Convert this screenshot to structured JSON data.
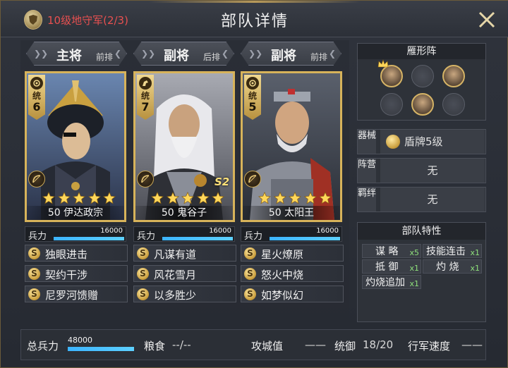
{
  "header": {
    "level_title": "10级地守军(2/3)",
    "page_title": "部队详情"
  },
  "generals": [
    {
      "role": "主将",
      "position": "前排",
      "cost_label": "统",
      "cost": "6",
      "level": "50",
      "name": "伊达政宗",
      "stars": 5,
      "troop_label": "兵力",
      "troops": "16000",
      "troop_fill": 1.0,
      "skills": [
        "独眼进击",
        "契约干涉",
        "尼罗河馈赠"
      ],
      "art_palette": {
        "bg": "#3a4a66",
        "armor": "#2a2e3a",
        "face": "#d8b890"
      }
    },
    {
      "role": "副将",
      "position": "后排",
      "cost_label": "统",
      "cost": "7",
      "level": "50",
      "name": "鬼谷子",
      "stars": 5,
      "badge": "S2",
      "troop_label": "兵力",
      "troops": "16000",
      "troop_fill": 1.0,
      "skills": [
        "凡谋有道",
        "风花雪月",
        "以多胜少"
      ],
      "art_palette": {
        "bg": "#6a6e78",
        "armor": "#3c3e44",
        "face": "#c9a27e"
      }
    },
    {
      "role": "副将",
      "position": "前排",
      "cost_label": "统",
      "cost": "5",
      "level": "50",
      "name": "太阳王",
      "stars": 5,
      "troop_label": "兵力",
      "troops": "16000",
      "troop_fill": 1.0,
      "skills": [
        "星火燎原",
        "怒火中烧",
        "如梦似幻"
      ],
      "art_palette": {
        "bg": "#3e4450",
        "armor": "#7a7e86",
        "face": "#d0a580"
      }
    }
  ],
  "formation": {
    "title": "雁形阵",
    "slots": [
      {
        "state": "filled",
        "crown": true
      },
      {
        "state": "empty"
      },
      {
        "state": "filled"
      },
      {
        "state": "empty"
      },
      {
        "state": "filled"
      },
      {
        "state": "empty"
      }
    ]
  },
  "info": [
    {
      "key": "器械",
      "value": "盾牌5级",
      "icon": "shield-icon"
    },
    {
      "key": "阵营",
      "value": "无"
    },
    {
      "key": "羁绊",
      "value": "无"
    }
  ],
  "traits": {
    "title": "部队特性",
    "items": [
      {
        "name": "谋 略",
        "count": "x5"
      },
      {
        "name": "技能连击",
        "count": "x1"
      },
      {
        "name": "抵 御",
        "count": "x1"
      },
      {
        "name": "灼 烧",
        "count": "x1"
      },
      {
        "name": "灼烧追加",
        "count": "x1"
      }
    ]
  },
  "footer": {
    "total_label": "总兵力",
    "total_value": "48000",
    "total_fill": 1.0,
    "food_label": "粮食",
    "food_value": "--/--",
    "siege_label": "攻城值",
    "siege_value": "——",
    "command_label": "统御",
    "command_value": "18/20",
    "speed_label": "行军速度",
    "speed_value": "——"
  },
  "colors": {
    "accent_gold": "#d7b35a",
    "level_red": "#e85050",
    "troop_blue": "#3cb4ff",
    "trait_green": "#8ee07a"
  }
}
